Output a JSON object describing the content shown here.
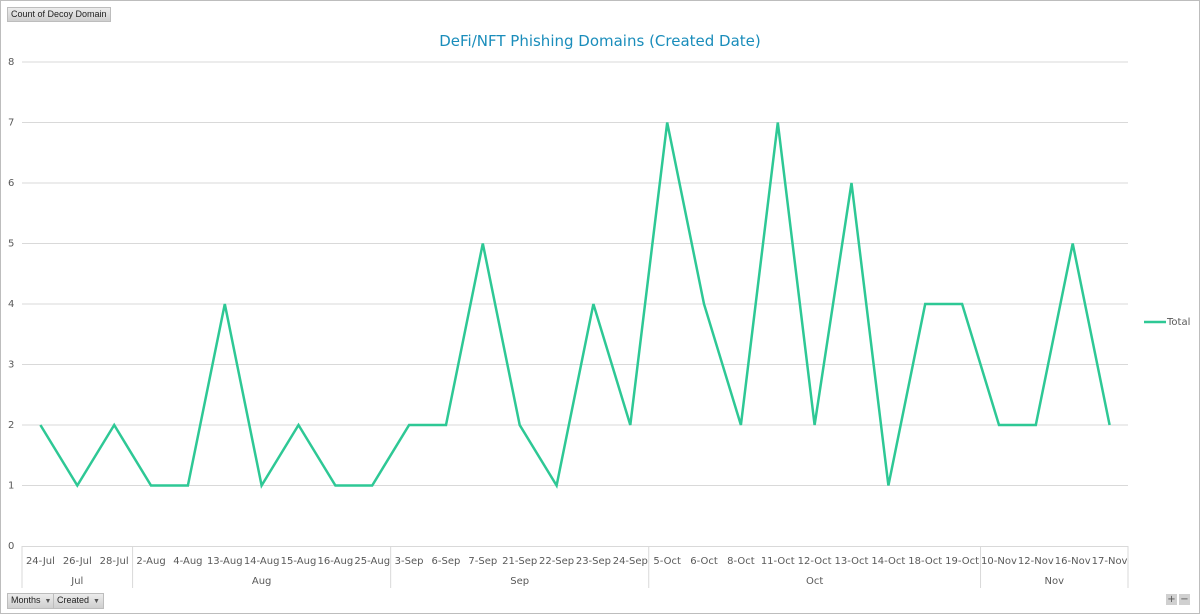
{
  "field_buttons": {
    "values_field": "Count of Decoy Domain",
    "axis_fields": [
      {
        "label": "Months",
        "icon": "dropdown-arrow-icon"
      },
      {
        "label": "Created",
        "icon": "dropdown-arrow-icon"
      }
    ]
  },
  "zoom_controls": {
    "expand": "+",
    "collapse": "−"
  },
  "colors": {
    "line": "#2ec895",
    "title": "#1a8dbb",
    "grid": "#d9d9d9",
    "axis_text": "#595959"
  },
  "chart_data": {
    "type": "line",
    "title": "DeFi/NFT Phishing Domains (Created Date)",
    "xlabel": "",
    "ylabel": "",
    "ylim": [
      0,
      8
    ],
    "yticks": [
      0,
      1,
      2,
      3,
      4,
      5,
      6,
      7,
      8
    ],
    "grid": true,
    "legend_position": "right",
    "categories": [
      "24-Jul",
      "26-Jul",
      "28-Jul",
      "2-Aug",
      "4-Aug",
      "13-Aug",
      "14-Aug",
      "15-Aug",
      "16-Aug",
      "25-Aug",
      "3-Sep",
      "6-Sep",
      "7-Sep",
      "21-Sep",
      "22-Sep",
      "23-Sep",
      "24-Sep",
      "5-Oct",
      "6-Oct",
      "8-Oct",
      "11-Oct",
      "12-Oct",
      "13-Oct",
      "14-Oct",
      "18-Oct",
      "19-Oct",
      "10-Nov",
      "12-Nov",
      "16-Nov",
      "17-Nov"
    ],
    "groups": [
      {
        "label": "Jul",
        "count": 3
      },
      {
        "label": "Aug",
        "count": 7
      },
      {
        "label": "Sep",
        "count": 7
      },
      {
        "label": "Oct",
        "count": 9
      },
      {
        "label": "Nov",
        "count": 4
      }
    ],
    "series": [
      {
        "name": "Total",
        "values": [
          2,
          1,
          2,
          1,
          1,
          4,
          1,
          2,
          1,
          1,
          2,
          2,
          5,
          2,
          1,
          4,
          2,
          7,
          4,
          2,
          7,
          2,
          6,
          1,
          4,
          4,
          2,
          2,
          5,
          2
        ]
      }
    ]
  }
}
